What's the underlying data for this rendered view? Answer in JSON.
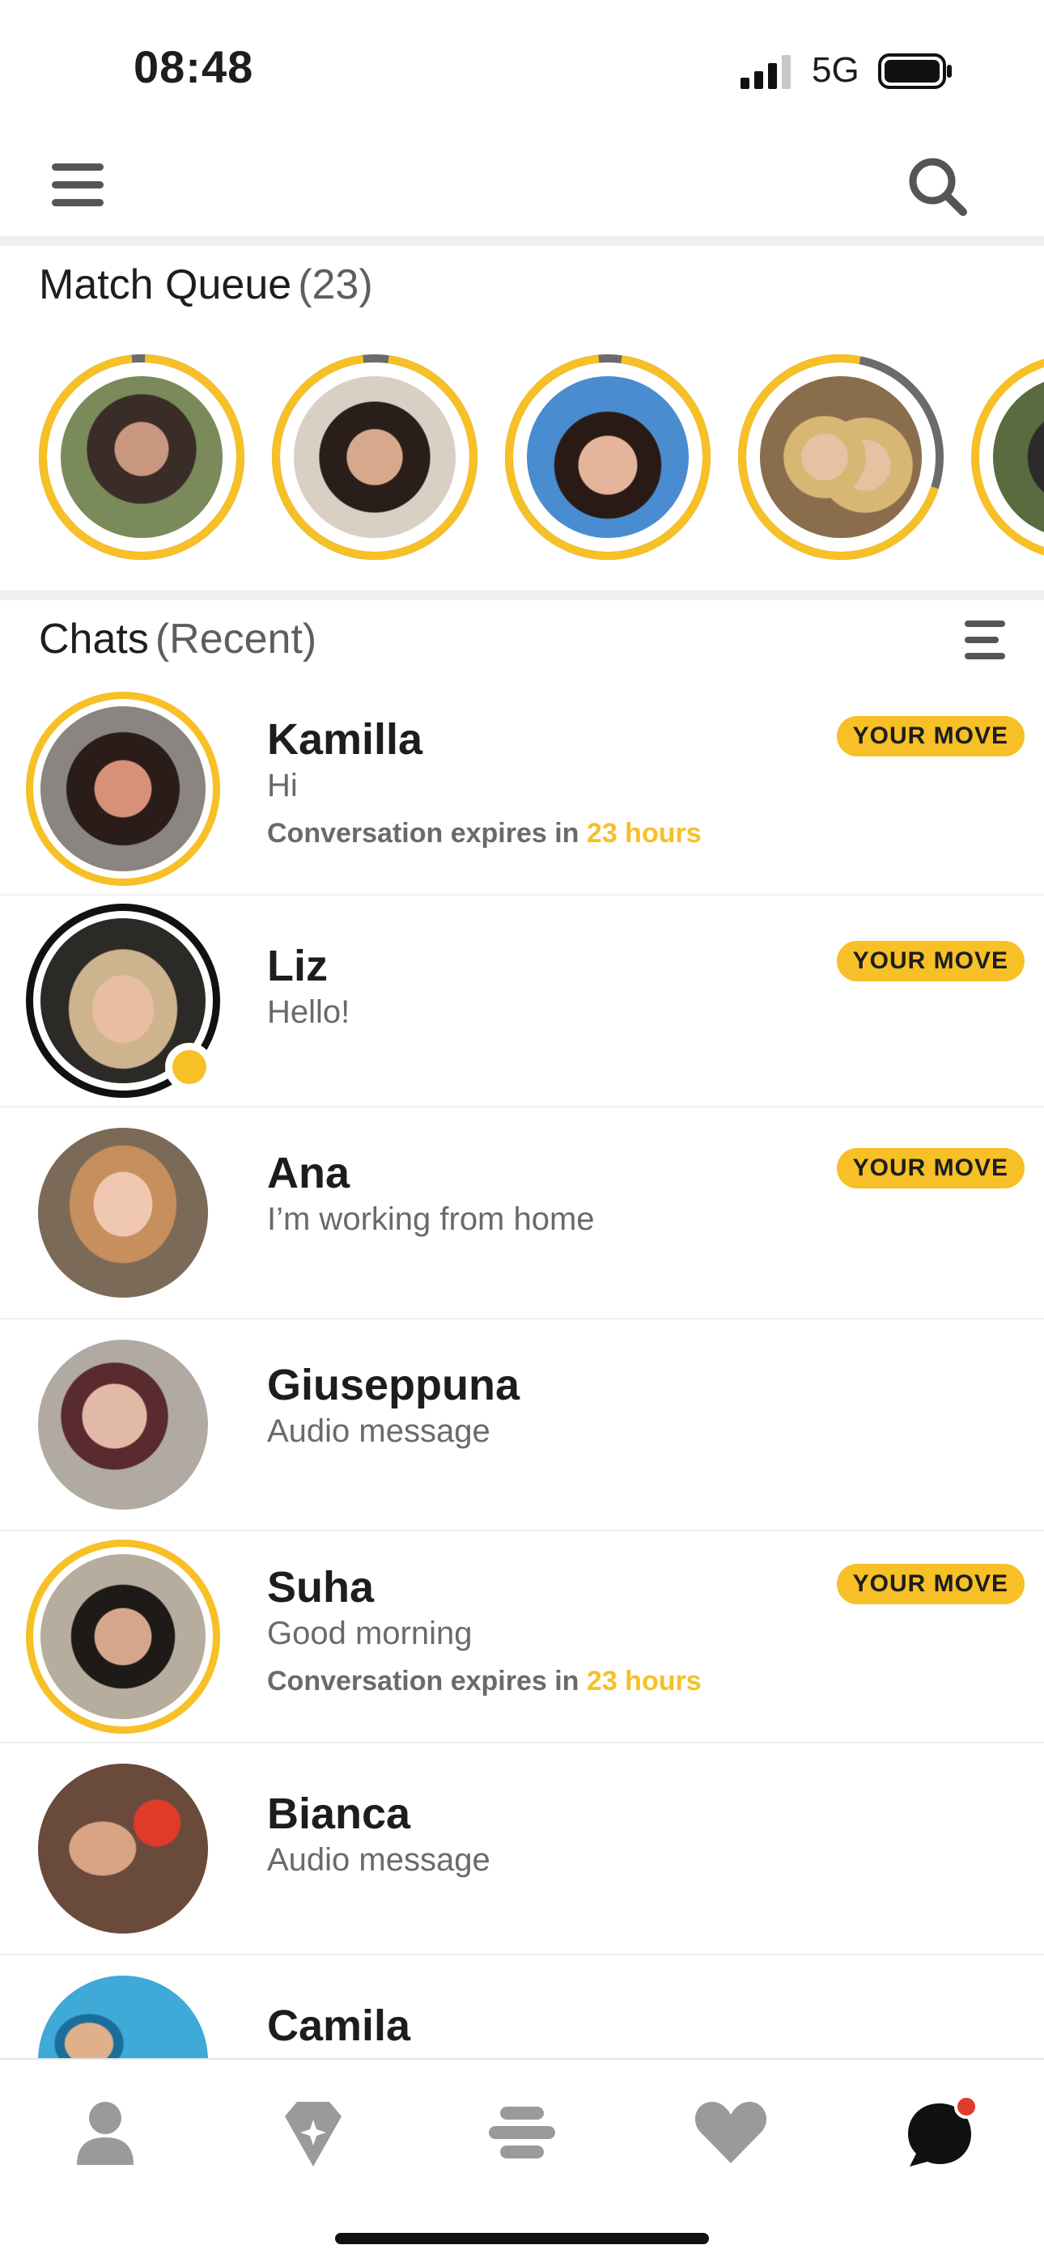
{
  "status_bar": {
    "time": "08:48",
    "network": "5G"
  },
  "header": {
    "menu_icon": "hamburger-menu-icon",
    "search_icon": "search-icon"
  },
  "match_queue": {
    "title": "Match Queue",
    "count": "(23)",
    "items": [
      {
        "name": "match-1",
        "photo_colors": [
          "#7a8a5a",
          "#3a2d28",
          "#c99680"
        ]
      },
      {
        "name": "match-2",
        "photo_colors": [
          "#d9cfc4",
          "#2a1e1a",
          "#d6a98c"
        ]
      },
      {
        "name": "match-3",
        "photo_colors": [
          "#4a8cd0",
          "#2a1a16",
          "#e4b59b"
        ]
      },
      {
        "name": "match-4",
        "photo_colors": [
          "#8a6d4c",
          "#d8b775",
          "#e8c0a2"
        ]
      },
      {
        "name": "match-5",
        "photo_colors": [
          "#5b6b40",
          "#2b2b2b",
          "#c9a07f"
        ]
      }
    ]
  },
  "chats": {
    "title": "Chats",
    "subtitle": "(Recent)",
    "filter_icon": "sort-lines-icon",
    "items": [
      {
        "name": "Kamilla",
        "message": "Hi",
        "expires_label": "Conversation expires in",
        "expires_value": "23 hours",
        "badge": "YOUR MOVE",
        "ring": "yellow",
        "photo_colors": [
          "#8a8580",
          "#2a1c18",
          "#d8907a"
        ]
      },
      {
        "name": "Liz",
        "message": "Hello!",
        "badge": "YOUR MOVE",
        "ring": "black",
        "online": true,
        "photo_colors": [
          "#2c2a26",
          "#cdb38e",
          "#e7bea4"
        ]
      },
      {
        "name": "Ana",
        "message": "I’m working from home",
        "badge": "YOUR MOVE",
        "ring": "none",
        "photo_colors": [
          "#7c6a58",
          "#c78e5e",
          "#f0c8b2"
        ]
      },
      {
        "name": "Giuseppuna",
        "message": "Audio message",
        "badge": "",
        "ring": "none",
        "photo_colors": [
          "#b0aaa2",
          "#5a2b2e",
          "#e2b8a6"
        ]
      },
      {
        "name": "Suha",
        "message": "Good morning",
        "expires_label": "Conversation expires in",
        "expires_value": "23 hours",
        "badge": "YOUR MOVE",
        "ring": "yellow",
        "photo_colors": [
          "#b7ad9e",
          "#1e1a18",
          "#d5a68c"
        ]
      },
      {
        "name": "Bianca",
        "message": "Audio message",
        "badge": "",
        "ring": "none",
        "photo_colors": [
          "#6a4a3a",
          "#e03a2a",
          "#d9a386"
        ]
      },
      {
        "name": "Camila",
        "message": "",
        "badge": "",
        "ring": "none",
        "photo_colors": [
          "#3fa9d8",
          "#1b6e9a",
          "#e0b08a"
        ]
      }
    ]
  },
  "bottom_nav": {
    "items": [
      {
        "icon": "profile-icon"
      },
      {
        "icon": "discover-diamond-icon"
      },
      {
        "icon": "people-stack-icon"
      },
      {
        "icon": "heart-icon"
      },
      {
        "icon": "chat-bubble-icon",
        "notification_color": "#e03a2a"
      }
    ]
  },
  "colors": {
    "accent": "#f6c026",
    "text": "#1d1d1d",
    "muted": "#6a6a6a",
    "divider": "#efefef"
  }
}
